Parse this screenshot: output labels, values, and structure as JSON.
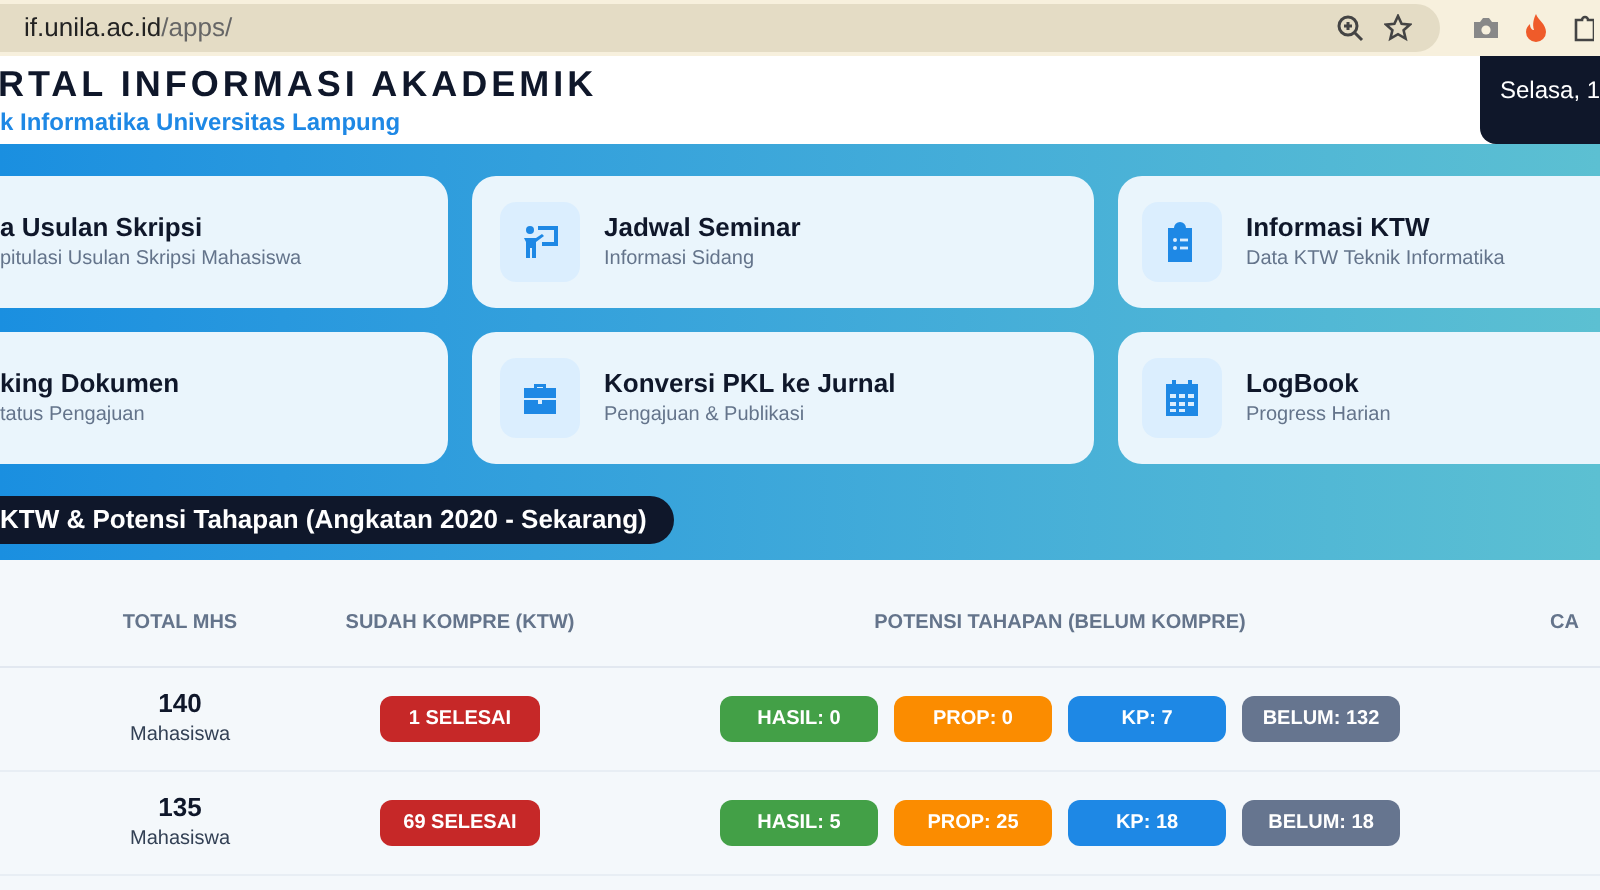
{
  "browser": {
    "url_host": "if.unila.ac.id",
    "url_path": "/apps/"
  },
  "header": {
    "title": "RTAL INFORMASI AKADEMIK",
    "subtitle": "k Informatika Universitas Lampung",
    "date": "Selasa, 1"
  },
  "menu_cards": [
    {
      "title": "a Usulan Skripsi",
      "subtitle": "pitulasi Usulan Skripsi Mahasiswa"
    },
    {
      "title": "Jadwal Seminar",
      "subtitle": "Informasi Sidang",
      "kind": "presenter"
    },
    {
      "title": "Informasi KTW",
      "subtitle": "Data KTW Teknik Informatika",
      "kind": "clipboard"
    },
    {
      "title": "king Dokumen",
      "subtitle": "tatus Pengajuan"
    },
    {
      "title": "Konversi PKL ke Jurnal",
      "subtitle": "Pengajuan & Publikasi",
      "kind": "briefcase"
    },
    {
      "title": "LogBook",
      "subtitle": "Progress Harian",
      "kind": "calendar"
    }
  ],
  "section_title": "KTW & Potensi Tahapan (Angkatan 2020 - Sekarang)",
  "table": {
    "columns": [
      "TOTAL MHS",
      "SUDAH KOMPRE (KTW)",
      "POTENSI TAHAPAN (BELUM KOMPRE)",
      "CA"
    ],
    "rows": [
      {
        "total": "140",
        "unit": "Mahasiswa",
        "selesai": "1 SELESAI",
        "potensi": [
          {
            "label": "HASIL: 0",
            "color": "#43a047"
          },
          {
            "label": "PROP: 0",
            "color": "#fb8c00"
          },
          {
            "label": "KP: 7",
            "color": "#1e88e5"
          },
          {
            "label": "BELUM: 132",
            "color": "#66758f"
          }
        ]
      },
      {
        "total": "135",
        "unit": "Mahasiswa",
        "selesai": "69 SELESAI",
        "potensi": [
          {
            "label": "HASIL: 5",
            "color": "#43a047"
          },
          {
            "label": "PROP: 25",
            "color": "#fb8c00"
          },
          {
            "label": "KP: 18",
            "color": "#1e88e5"
          },
          {
            "label": "BELUM: 18",
            "color": "#66758f"
          }
        ]
      }
    ]
  }
}
